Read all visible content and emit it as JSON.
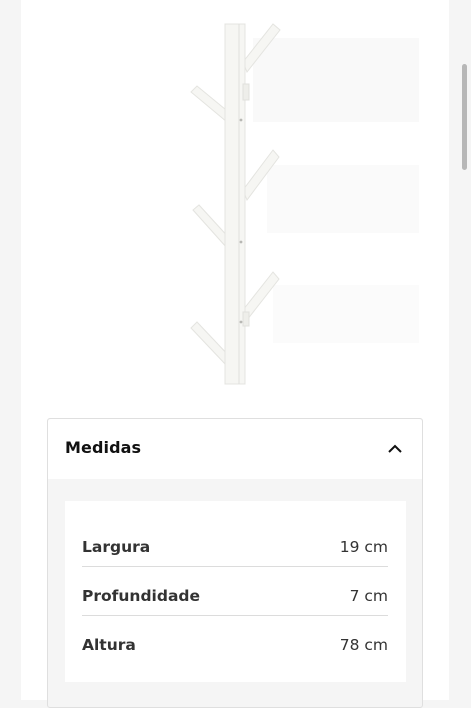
{
  "measurements": {
    "title": "Medidas",
    "rows": [
      {
        "label": "Largura",
        "value": "19 cm"
      },
      {
        "label": "Profundidade",
        "value": "7 cm"
      },
      {
        "label": "Altura",
        "value": "78 cm"
      }
    ]
  },
  "icons": {
    "toggle": "chevron-up-icon"
  },
  "colors": {
    "page_background": "#f5f5f5",
    "card_background": "#ffffff",
    "text": "#111111",
    "divider": "#dcdcdc",
    "product": "#f2f2ee"
  }
}
